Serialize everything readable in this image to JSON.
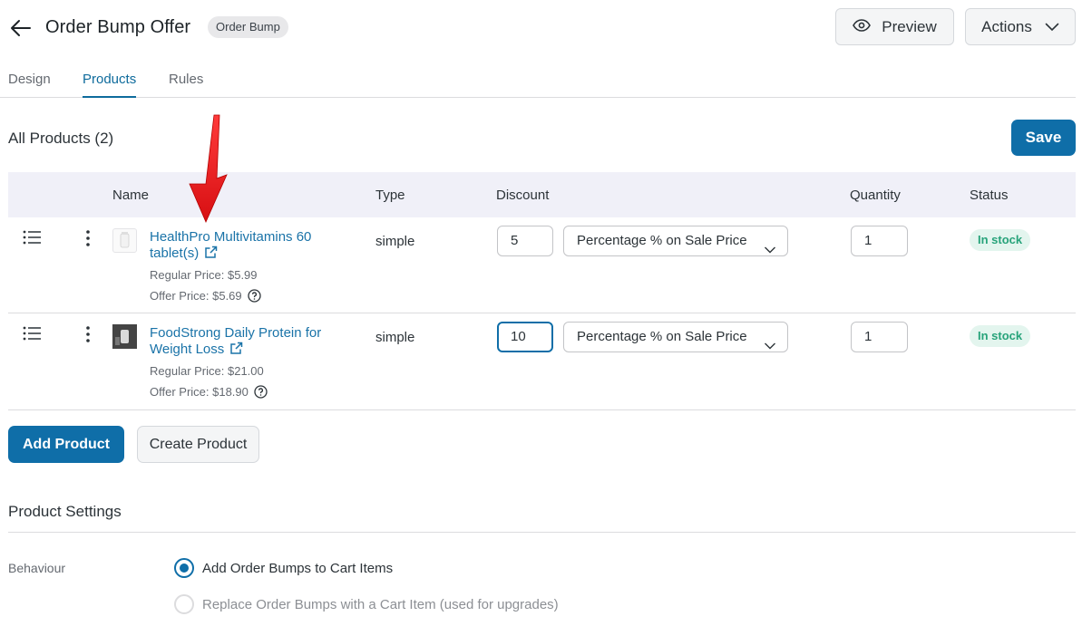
{
  "header": {
    "title": "Order Bump Offer",
    "badge": "Order Bump",
    "preview_label": "Preview",
    "actions_label": "Actions"
  },
  "tabs": [
    {
      "label": "Design",
      "active": false
    },
    {
      "label": "Products",
      "active": true
    },
    {
      "label": "Rules",
      "active": false
    }
  ],
  "products_section": {
    "title": "All Products (2)",
    "save_label": "Save"
  },
  "table": {
    "columns": [
      "Name",
      "Type",
      "Discount",
      "Quantity",
      "Status"
    ],
    "rows": [
      {
        "name": "HealthPro Multivitamins 60 tablet(s)",
        "regular_price": "Regular Price: $5.99",
        "offer_price": "Offer Price: $5.69",
        "type": "simple",
        "discount": "5",
        "discount_type": "Percentage % on Sale Price",
        "quantity": "1",
        "status": "In stock"
      },
      {
        "name": "FoodStrong Daily Protein for Weight Loss",
        "regular_price": "Regular Price: $21.00",
        "offer_price": "Offer Price: $18.90",
        "type": "simple",
        "discount": "10",
        "discount_type": "Percentage % on Sale Price",
        "quantity": "1",
        "status": "In stock"
      }
    ]
  },
  "buttons": {
    "add_product": "Add Product",
    "create_product": "Create Product"
  },
  "settings": {
    "title": "Product Settings",
    "behaviour_label": "Behaviour",
    "options": [
      {
        "label": "Add Order Bumps to Cart Items",
        "checked": true
      },
      {
        "label": "Replace Order Bumps with a Cart Item (used for upgrades)",
        "checked": false
      }
    ]
  },
  "colors": {
    "accent": "#0f6ea8",
    "link": "#1a73a8",
    "stock_text": "#27a37a",
    "stock_bg": "#e3f5ee",
    "annotation_arrow": "#e8141a"
  }
}
